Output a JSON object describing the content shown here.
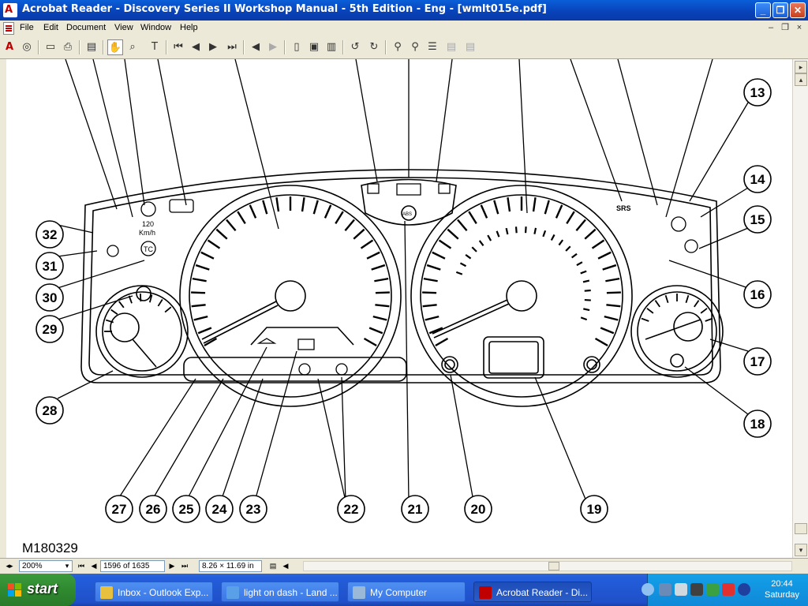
{
  "window": {
    "title": "Acrobat Reader - Discovery Series II Workshop Manual - 5th Edition - Eng - [wmlt015e.pdf]",
    "controls": {
      "minimize": "_",
      "maximize": "❐",
      "close": "✕"
    }
  },
  "menubar": {
    "items": [
      "File",
      "Edit",
      "Document",
      "View",
      "Window",
      "Help"
    ],
    "mdi_controls": {
      "minimize": "–",
      "restore": "❐",
      "close": "×"
    }
  },
  "toolbar": {
    "icons": [
      "acrobat-icon",
      "update-icon",
      "open-icon",
      "print-icon",
      "bookmarks-toggle-icon",
      "hand-tool-icon",
      "zoom-tool-icon",
      "text-select-icon",
      "first-page-icon",
      "previous-page-icon",
      "next-page-icon",
      "last-page-icon",
      "go-back-icon",
      "go-forward-icon",
      "actual-size-icon",
      "fit-page-icon",
      "fit-width-icon",
      "rotate-left-icon",
      "rotate-right-icon",
      "find-icon",
      "search-icon",
      "search-results-icon",
      "prev-highlight-icon",
      "next-highlight-icon"
    ]
  },
  "document": {
    "figure_label": "M180329",
    "callouts": [
      "13",
      "14",
      "15",
      "16",
      "17",
      "18",
      "19",
      "20",
      "21",
      "22",
      "23",
      "24",
      "25",
      "26",
      "27",
      "28",
      "29",
      "30",
      "31",
      "32"
    ],
    "panel_text": {
      "speed_limit": "120",
      "speed_unit": "Km/h",
      "srs": "SRS",
      "tc": "TC",
      "abs": "ABS"
    }
  },
  "statusbar": {
    "zoom": "200%",
    "page": "1596 of 1635",
    "page_size": "8.26 × 11.69 in"
  },
  "taskbar": {
    "start_label": "start",
    "tasks": [
      {
        "label": "Inbox - Outlook Exp...",
        "active": false
      },
      {
        "label": "light on dash - Land ...",
        "active": false
      },
      {
        "label": "My Computer",
        "active": false
      },
      {
        "label": "Acrobat Reader - Di...",
        "active": true
      }
    ],
    "clock": {
      "time": "20:44",
      "day": "Saturday"
    }
  }
}
